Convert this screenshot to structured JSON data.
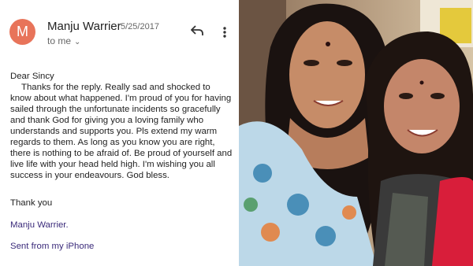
{
  "email": {
    "avatar_letter": "M",
    "sender": "Manju Warrier",
    "date": "5/25/2017",
    "recipient": "to me",
    "greeting": "Dear Sincy",
    "body": "Thanks for the reply. Really sad and shocked to know about what happened. I'm proud of you for having sailed through the unfortunate incidents so gracefully and thank God for giving you a loving family who understands and supports you. Pls extend my warm regards to them. As long as you know you are right, there is nothing to be afraid of. Be proud of yourself and live life with your head held high.  I'm wishing you all success in your endeavours. God bless.",
    "closing": "Thank you",
    "signature": "Manju Warrier.",
    "footer": "Sent from my iPhone"
  },
  "icons": {
    "reply": "reply-icon",
    "more": "more-vert-icon",
    "chevron": "chevron-down-icon"
  },
  "colors": {
    "avatar": "#e8745a",
    "signature": "#3a2a7a"
  }
}
